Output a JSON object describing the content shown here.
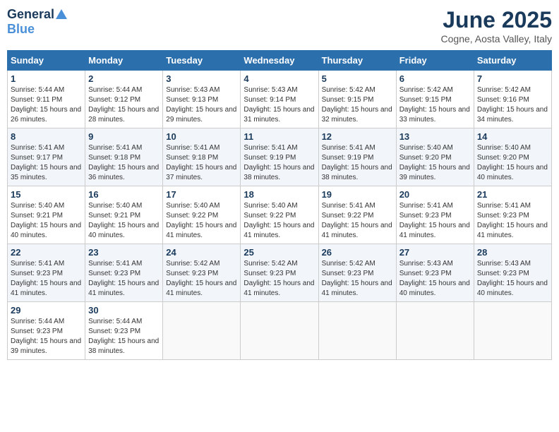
{
  "header": {
    "logo_general": "General",
    "logo_blue": "Blue",
    "month_year": "June 2025",
    "location": "Cogne, Aosta Valley, Italy"
  },
  "days_of_week": [
    "Sunday",
    "Monday",
    "Tuesday",
    "Wednesday",
    "Thursday",
    "Friday",
    "Saturday"
  ],
  "weeks": [
    [
      {
        "day": "1",
        "sunrise": "5:44 AM",
        "sunset": "9:11 PM",
        "daylight": "15 hours and 26 minutes."
      },
      {
        "day": "2",
        "sunrise": "5:44 AM",
        "sunset": "9:12 PM",
        "daylight": "15 hours and 28 minutes."
      },
      {
        "day": "3",
        "sunrise": "5:43 AM",
        "sunset": "9:13 PM",
        "daylight": "15 hours and 29 minutes."
      },
      {
        "day": "4",
        "sunrise": "5:43 AM",
        "sunset": "9:14 PM",
        "daylight": "15 hours and 31 minutes."
      },
      {
        "day": "5",
        "sunrise": "5:42 AM",
        "sunset": "9:15 PM",
        "daylight": "15 hours and 32 minutes."
      },
      {
        "day": "6",
        "sunrise": "5:42 AM",
        "sunset": "9:15 PM",
        "daylight": "15 hours and 33 minutes."
      },
      {
        "day": "7",
        "sunrise": "5:42 AM",
        "sunset": "9:16 PM",
        "daylight": "15 hours and 34 minutes."
      }
    ],
    [
      {
        "day": "8",
        "sunrise": "5:41 AM",
        "sunset": "9:17 PM",
        "daylight": "15 hours and 35 minutes."
      },
      {
        "day": "9",
        "sunrise": "5:41 AM",
        "sunset": "9:18 PM",
        "daylight": "15 hours and 36 minutes."
      },
      {
        "day": "10",
        "sunrise": "5:41 AM",
        "sunset": "9:18 PM",
        "daylight": "15 hours and 37 minutes."
      },
      {
        "day": "11",
        "sunrise": "5:41 AM",
        "sunset": "9:19 PM",
        "daylight": "15 hours and 38 minutes."
      },
      {
        "day": "12",
        "sunrise": "5:41 AM",
        "sunset": "9:19 PM",
        "daylight": "15 hours and 38 minutes."
      },
      {
        "day": "13",
        "sunrise": "5:40 AM",
        "sunset": "9:20 PM",
        "daylight": "15 hours and 39 minutes."
      },
      {
        "day": "14",
        "sunrise": "5:40 AM",
        "sunset": "9:20 PM",
        "daylight": "15 hours and 40 minutes."
      }
    ],
    [
      {
        "day": "15",
        "sunrise": "5:40 AM",
        "sunset": "9:21 PM",
        "daylight": "15 hours and 40 minutes."
      },
      {
        "day": "16",
        "sunrise": "5:40 AM",
        "sunset": "9:21 PM",
        "daylight": "15 hours and 40 minutes."
      },
      {
        "day": "17",
        "sunrise": "5:40 AM",
        "sunset": "9:22 PM",
        "daylight": "15 hours and 41 minutes."
      },
      {
        "day": "18",
        "sunrise": "5:40 AM",
        "sunset": "9:22 PM",
        "daylight": "15 hours and 41 minutes."
      },
      {
        "day": "19",
        "sunrise": "5:41 AM",
        "sunset": "9:22 PM",
        "daylight": "15 hours and 41 minutes."
      },
      {
        "day": "20",
        "sunrise": "5:41 AM",
        "sunset": "9:23 PM",
        "daylight": "15 hours and 41 minutes."
      },
      {
        "day": "21",
        "sunrise": "5:41 AM",
        "sunset": "9:23 PM",
        "daylight": "15 hours and 41 minutes."
      }
    ],
    [
      {
        "day": "22",
        "sunrise": "5:41 AM",
        "sunset": "9:23 PM",
        "daylight": "15 hours and 41 minutes."
      },
      {
        "day": "23",
        "sunrise": "5:41 AM",
        "sunset": "9:23 PM",
        "daylight": "15 hours and 41 minutes."
      },
      {
        "day": "24",
        "sunrise": "5:42 AM",
        "sunset": "9:23 PM",
        "daylight": "15 hours and 41 minutes."
      },
      {
        "day": "25",
        "sunrise": "5:42 AM",
        "sunset": "9:23 PM",
        "daylight": "15 hours and 41 minutes."
      },
      {
        "day": "26",
        "sunrise": "5:42 AM",
        "sunset": "9:23 PM",
        "daylight": "15 hours and 41 minutes."
      },
      {
        "day": "27",
        "sunrise": "5:43 AM",
        "sunset": "9:23 PM",
        "daylight": "15 hours and 40 minutes."
      },
      {
        "day": "28",
        "sunrise": "5:43 AM",
        "sunset": "9:23 PM",
        "daylight": "15 hours and 40 minutes."
      }
    ],
    [
      {
        "day": "29",
        "sunrise": "5:44 AM",
        "sunset": "9:23 PM",
        "daylight": "15 hours and 39 minutes."
      },
      {
        "day": "30",
        "sunrise": "5:44 AM",
        "sunset": "9:23 PM",
        "daylight": "15 hours and 38 minutes."
      },
      null,
      null,
      null,
      null,
      null
    ]
  ],
  "labels": {
    "sunrise": "Sunrise:",
    "sunset": "Sunset:",
    "daylight": "Daylight:"
  }
}
